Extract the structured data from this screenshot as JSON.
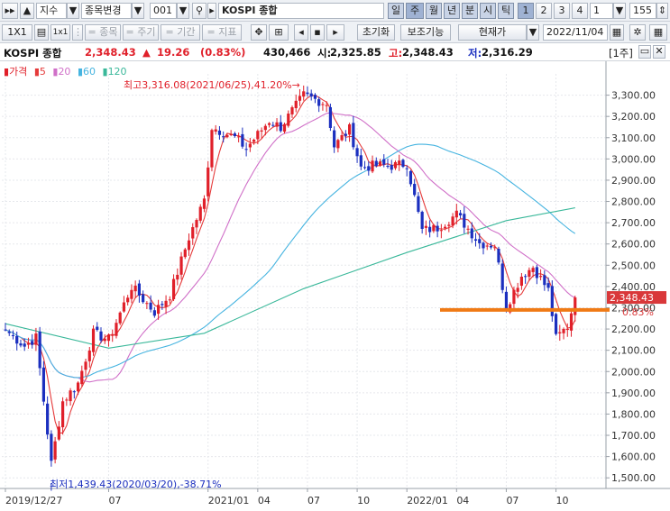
{
  "toolbar1": {
    "index_type": "지수",
    "change_item": "종목변경",
    "code": "001",
    "name": "KOSPI 종합",
    "periods": [
      "일",
      "주",
      "월",
      "년",
      "분",
      "시",
      "틱"
    ],
    "active_period": "주",
    "numbers": [
      "1",
      "2",
      "3",
      "4"
    ],
    "active_number": "1",
    "interval": "1",
    "count": "155"
  },
  "toolbar2": {
    "ratio_label": "1X1",
    "ratio_icon": "1x1",
    "stock_label": "= 종목",
    "cycle_label": "= 주기",
    "period_label": "= 기간",
    "indicator_label": "= 지표",
    "reset_label": "초기화",
    "aux_label": "보조기능",
    "price_mode": "현재가",
    "date": "2022/11/04"
  },
  "infobar": {
    "name": "KOSPI 종합",
    "price": "2,348.43",
    "change_arrow": "▲",
    "change": "19.26",
    "change_pct": "(0.83%)",
    "volume": "430,466",
    "open_label": "시:",
    "open": "2,325.85",
    "high_label": "고:",
    "high": "2,348.43",
    "low_label": "저:",
    "low": "2,316.29",
    "pane_label": "[1주]"
  },
  "legend": {
    "price": "가격",
    "ma5": "5",
    "ma20": "20",
    "ma60": "60",
    "ma120": "120"
  },
  "colors": {
    "up": "#e0202a",
    "down": "#1b2fbf",
    "ma5": "#e53a3a",
    "ma20": "#d070c8",
    "ma60": "#46b4e0",
    "ma120": "#3ab89a",
    "support": "#f07a14",
    "price_tag": "#d9383a"
  },
  "annotations": {
    "high": "최고3,316.08(2021/06/25),41.20%→",
    "low": "최저1,439.43(2020/03/20),-38.71%",
    "price_tag": "2,348.43",
    "pct_tag": "0.83%"
  },
  "chart_data": {
    "type": "candlestick",
    "y_ticks": [
      3300,
      3200,
      3100,
      3000,
      2900,
      2800,
      2700,
      2600,
      2500,
      2400,
      2300,
      2200,
      2100,
      2000,
      1900,
      1800,
      1700,
      1600,
      1500
    ],
    "y_tick_labels": [
      "3,300.00",
      "3,200.00",
      "3,100.00",
      "3,000.00",
      "2,900.00",
      "2,800.00",
      "2,700.00",
      "2,600.00",
      "2,500.00",
      "2,400.00",
      "2,300.00",
      "2,200.00",
      "2,100.00",
      "2,000.00",
      "1,900.00",
      "1,800.00",
      "1,700.00",
      "1,600.00",
      "1,500.00"
    ],
    "x_labels": [
      "2019/12/27",
      "07",
      "2021/01",
      "04",
      "07",
      "10",
      "2022/01",
      "04",
      "07",
      "10"
    ],
    "x_label_dates": [
      "2019-12-27",
      "2020-07-03",
      "2021-01-01",
      "2021-04-02",
      "2021-07-02",
      "2021-10-01",
      "2021-12-31",
      "2022-04-01",
      "2022-07-01",
      "2022-09-30"
    ],
    "first_date": "2019-12-27",
    "last_date": "2022-11-04",
    "weeks": 150,
    "ylim": [
      1450,
      3400
    ],
    "support_level": 2290,
    "high": {
      "value": 3316.08,
      "date": "2021-06-25"
    },
    "low": {
      "value": 1439.43,
      "date": "2020-03-20"
    },
    "close_path": [
      {
        "date": "2019-12-27",
        "value": 2197
      },
      {
        "date": "2020-01-31",
        "value": 2120
      },
      {
        "date": "2020-02-21",
        "value": 2160
      },
      {
        "date": "2020-03-20",
        "value": 1566
      },
      {
        "date": "2020-04-10",
        "value": 1860
      },
      {
        "date": "2020-05-08",
        "value": 1945
      },
      {
        "date": "2020-06-05",
        "value": 2180
      },
      {
        "date": "2020-07-03",
        "value": 2150
      },
      {
        "date": "2020-08-14",
        "value": 2400
      },
      {
        "date": "2020-09-25",
        "value": 2280
      },
      {
        "date": "2020-10-23",
        "value": 2360
      },
      {
        "date": "2020-11-27",
        "value": 2630
      },
      {
        "date": "2020-12-25",
        "value": 2806
      },
      {
        "date": "2021-01-08",
        "value": 3150
      },
      {
        "date": "2021-02-19",
        "value": 3100
      },
      {
        "date": "2021-03-12",
        "value": 3050
      },
      {
        "date": "2021-04-23",
        "value": 3180
      },
      {
        "date": "2021-05-14",
        "value": 3150
      },
      {
        "date": "2021-06-25",
        "value": 3300
      },
      {
        "date": "2021-08-06",
        "value": 3260
      },
      {
        "date": "2021-08-20",
        "value": 3060
      },
      {
        "date": "2021-09-17",
        "value": 3140
      },
      {
        "date": "2021-10-08",
        "value": 2960
      },
      {
        "date": "2021-11-05",
        "value": 2970
      },
      {
        "date": "2021-12-03",
        "value": 2968
      },
      {
        "date": "2021-12-31",
        "value": 2977
      },
      {
        "date": "2022-01-28",
        "value": 2663
      },
      {
        "date": "2022-02-25",
        "value": 2676
      },
      {
        "date": "2022-04-01",
        "value": 2740
      },
      {
        "date": "2022-05-13",
        "value": 2604
      },
      {
        "date": "2022-06-10",
        "value": 2595
      },
      {
        "date": "2022-07-01",
        "value": 2305
      },
      {
        "date": "2022-07-29",
        "value": 2451
      },
      {
        "date": "2022-08-19",
        "value": 2492
      },
      {
        "date": "2022-09-16",
        "value": 2382
      },
      {
        "date": "2022-09-30",
        "value": 2155
      },
      {
        "date": "2022-10-21",
        "value": 2213
      },
      {
        "date": "2022-11-04",
        "value": 2348.43
      }
    ],
    "ma120_path": [
      {
        "date": "2019-12-27",
        "value": 2225
      },
      {
        "date": "2020-07-03",
        "value": 2110
      },
      {
        "date": "2020-12-25",
        "value": 2180
      },
      {
        "date": "2021-06-25",
        "value": 2390
      },
      {
        "date": "2021-12-31",
        "value": 2560
      },
      {
        "date": "2022-07-01",
        "value": 2710
      },
      {
        "date": "2022-11-04",
        "value": 2770
      }
    ]
  }
}
